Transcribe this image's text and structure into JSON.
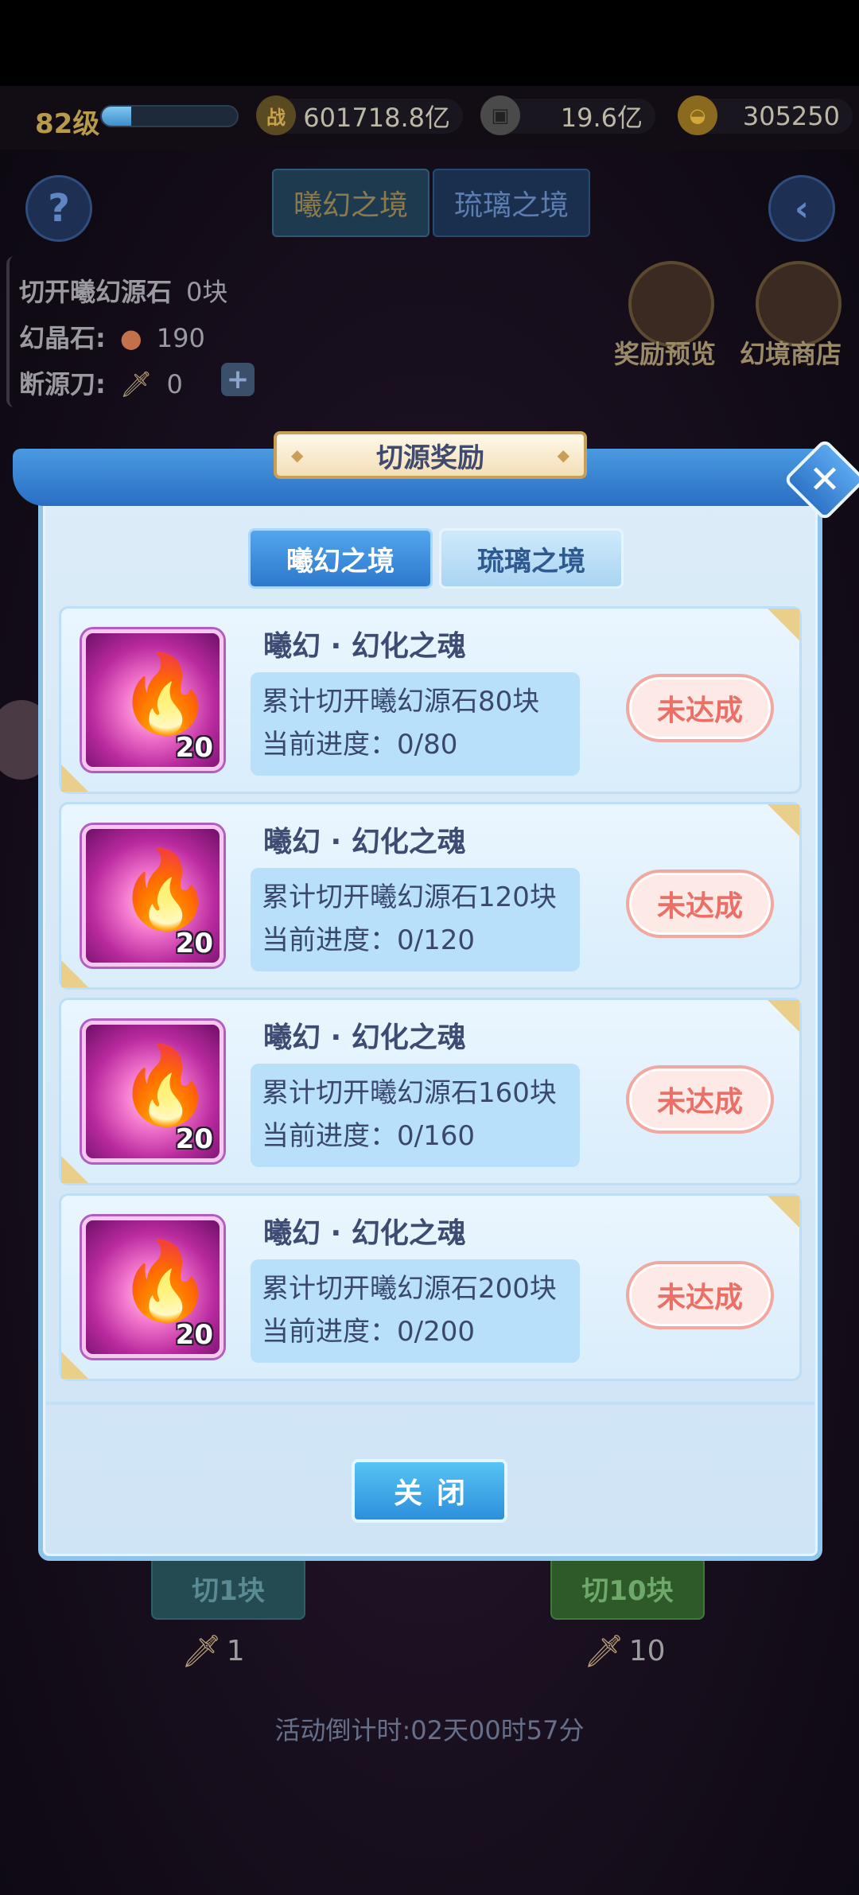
{
  "hud": {
    "level": "82级",
    "xp_fraction": 0.22,
    "combat_power": "601718.8亿",
    "copper": "19.6亿",
    "gold": "305250"
  },
  "bg": {
    "tab_xihuan": "曦幻之境",
    "tab_liuli": "琉璃之境",
    "info_cut_label": "切开曦幻源石",
    "info_cut_value": "0块",
    "info_crystal_label": "幻晶石:",
    "info_crystal_value": "190",
    "info_knife_label": "断源刀:",
    "info_knife_value": "0",
    "reward_preview": "奖励预览",
    "shop": "幻境商店",
    "cut1_label": "切1块",
    "cut1_cost": "1",
    "cut10_label": "切10块",
    "cut10_cost": "10",
    "countdown": "活动倒计时:02天00时57分"
  },
  "dialog": {
    "title": "切源奖励",
    "tabs": [
      "曦幻之境",
      "琉璃之境"
    ],
    "rewards": [
      {
        "name": "曦幻 · 幻化之魂",
        "count": "20",
        "requirement": "累计切开曦幻源石80块",
        "progress": "当前进度：0/80",
        "status": "未达成"
      },
      {
        "name": "曦幻 · 幻化之魂",
        "count": "20",
        "requirement": "累计切开曦幻源石120块",
        "progress": "当前进度：0/120",
        "status": "未达成"
      },
      {
        "name": "曦幻 · 幻化之魂",
        "count": "20",
        "requirement": "累计切开曦幻源石160块",
        "progress": "当前进度：0/160",
        "status": "未达成"
      },
      {
        "name": "曦幻 · 幻化之魂",
        "count": "20",
        "requirement": "累计切开曦幻源石200块",
        "progress": "当前进度：0/200",
        "status": "未达成"
      }
    ],
    "close_label": "关闭"
  }
}
